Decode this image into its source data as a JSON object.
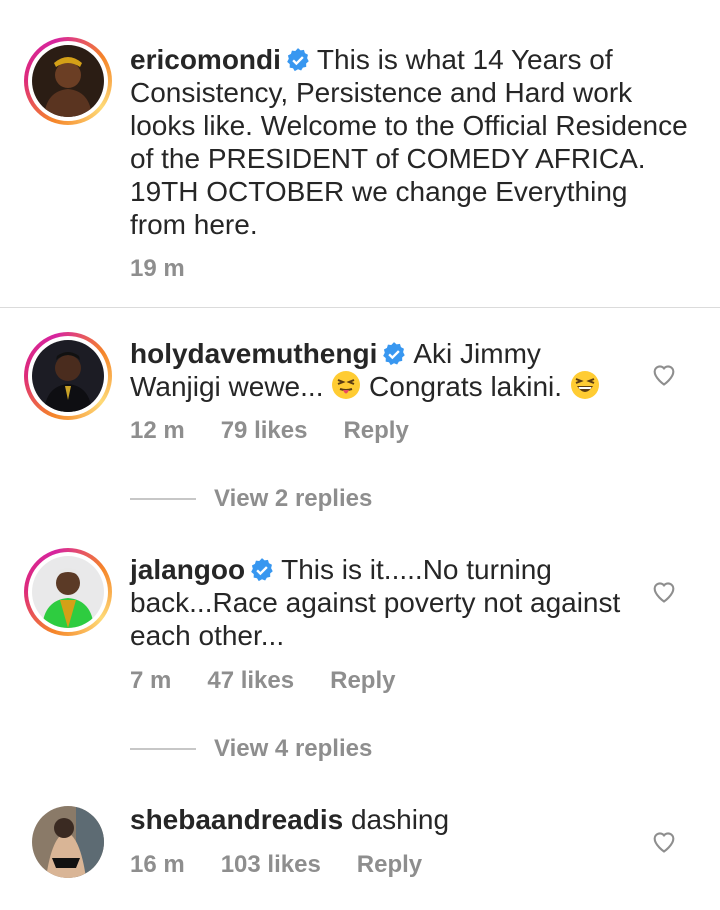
{
  "caption": {
    "username": "ericomondi",
    "text": "This is what 14 Years of Consistency, Persistence and Hard work looks like. Welcome to the Official Residence of the PRESIDENT of COMEDY AFRICA. 19TH OCTOBER we change Everything from here.",
    "time": "19 m"
  },
  "comments": [
    {
      "username": "holydavemuthengi",
      "text_part1": "Aki Jimmy Wanjigi wewe...",
      "emoji1": "squinting-tongue-emoji",
      "text_part2": "Congrats lakini.",
      "emoji2": "grinning-squinting-emoji",
      "time": "12 m",
      "likes": "79 likes",
      "reply": "Reply",
      "view_replies": "View 2 replies"
    },
    {
      "username": "jalangoo",
      "text": "This is it.....No turning back...Race against poverty not against each other...",
      "time": "7 m",
      "likes": "47 likes",
      "reply": "Reply",
      "view_replies": "View 4 replies"
    },
    {
      "username": "shebaandreadis",
      "text": "dashing",
      "time": "16 m",
      "likes": "103 likes",
      "reply": "Reply"
    }
  ],
  "colors": {
    "verified_badge": "#3897f0",
    "meta_text": "#8e8e8e",
    "ring_gradient": [
      "#f58529",
      "#dd2a7b",
      "#feda77"
    ]
  }
}
